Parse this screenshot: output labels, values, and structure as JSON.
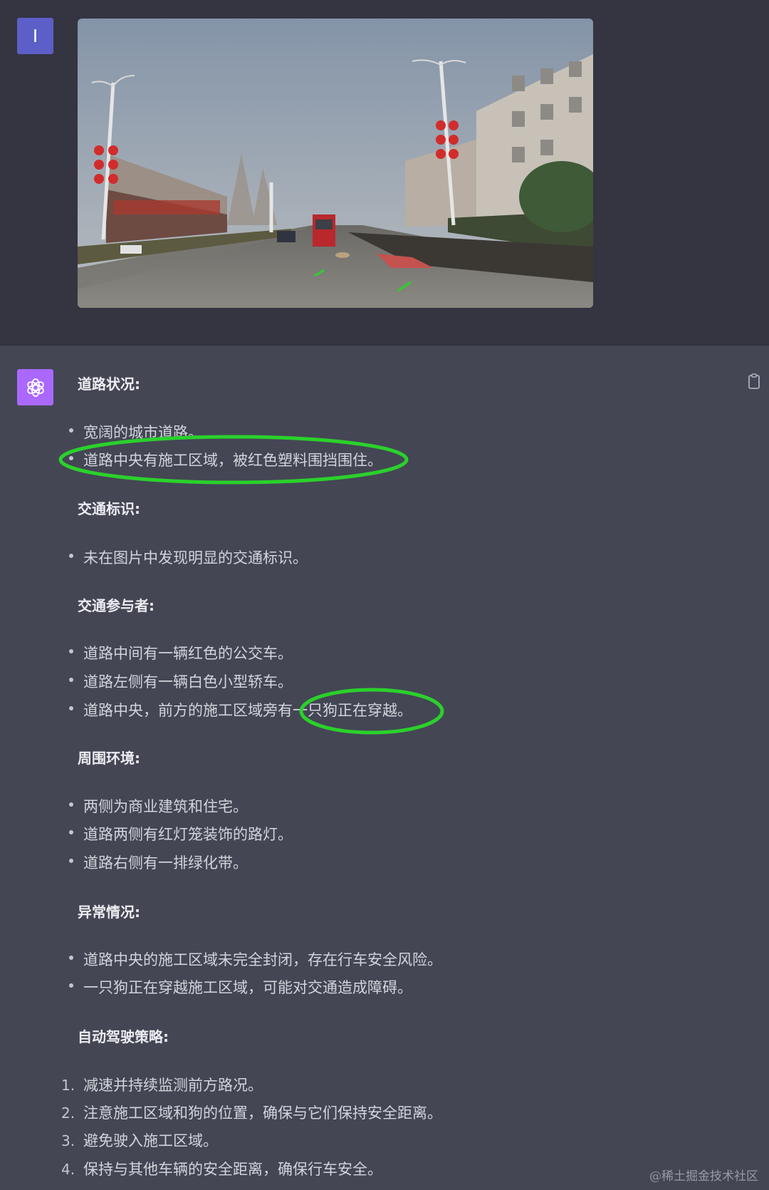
{
  "user": {
    "avatar_initial": "I"
  },
  "response": {
    "sections": [
      {
        "heading": "道路状况:",
        "bullets": [
          "宽阔的城市道路。",
          "道路中央有施工区域，被红色塑料围挡围住。"
        ]
      },
      {
        "heading": "交通标识:",
        "bullets": [
          "未在图片中发现明显的交通标识。"
        ]
      },
      {
        "heading": "交通参与者:",
        "bullets": [
          "道路中间有一辆红色的公交车。",
          "道路左侧有一辆白色小型轿车。",
          "道路中央，前方的施工区域旁有一只狗正在穿越。"
        ]
      },
      {
        "heading": "周围环境:",
        "bullets": [
          "两侧为商业建筑和住宅。",
          "道路两侧有红灯笼装饰的路灯。",
          "道路右侧有一排绿化带。"
        ]
      },
      {
        "heading": "异常情况:",
        "bullets": [
          "道路中央的施工区域未完全封闭，存在行车安全风险。",
          "一只狗正在穿越施工区域，可能对交通造成障碍。"
        ]
      },
      {
        "heading": "自动驾驶策略:",
        "numbered": [
          {
            "n": "1.",
            "text": "减速并持续监测前方路况。"
          },
          {
            "n": "2.",
            "text": "注意施工区域和狗的位置，确保与它们保持安全距离。"
          },
          {
            "n": "3.",
            "text": "避免驶入施工区域。"
          },
          {
            "n": "4.",
            "text": "保持与其他车辆的安全距离，确保行车安全。"
          }
        ]
      }
    ]
  },
  "watermark": "@稀土掘金技术社区",
  "colors": {
    "user_bg": "#343541",
    "assistant_bg": "#444654",
    "user_avatar": "#5b5fc7",
    "assistant_avatar": "#ab68ff",
    "annotation_green": "#2bd12b"
  },
  "icons": {
    "assistant_avatar": "openai-logo-icon",
    "copy": "clipboard-icon"
  }
}
